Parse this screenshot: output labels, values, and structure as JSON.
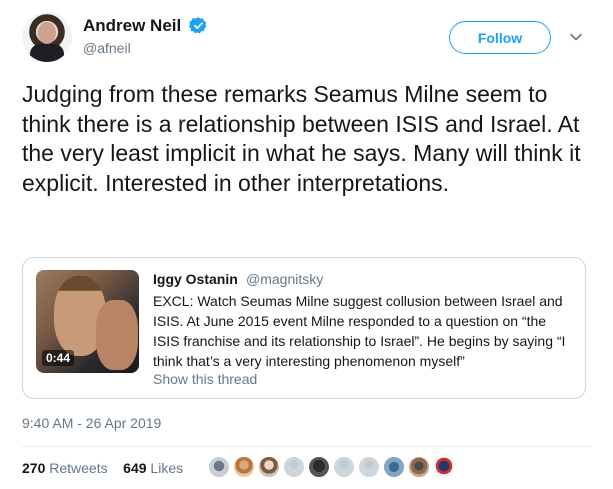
{
  "author": {
    "name": "Andrew Neil",
    "handle": "@afneil",
    "verified": true
  },
  "follow_label": "Follow",
  "tweet_text": "Judging from these remarks Seamus Milne seem to think there is a relationship between ISIS and Israel. At the very least implicit in what he says. Many will think it explicit. Interested in other interpretations.",
  "quoted": {
    "name": "Iggy Ostanin",
    "handle": "@magnitsky",
    "video_duration": "0:44",
    "text": "EXCL: Watch Seumas Milne suggest collusion between Israel and ISIS. At June 2015 event Milne responded to a question on “the ISIS franchise and its relationship to Israel”. He begins by saying “I think that’s a very interesting phenomenon myself”",
    "show_thread": "Show this thread"
  },
  "timestamp": "9:40 AM - 26 Apr 2019",
  "stats": {
    "retweets_count": "270",
    "retweets_label": "Retweets",
    "likes_count": "649",
    "likes_label": "Likes"
  },
  "colors": {
    "accent": "#1da1f2",
    "secondary_text": "#657786",
    "border": "#ccd6dd"
  },
  "liker_avatars": [
    "avatar-1",
    "avatar-2",
    "avatar-3",
    "avatar-4",
    "avatar-5",
    "avatar-6",
    "avatar-7",
    "avatar-8",
    "avatar-9",
    "avatar-10"
  ]
}
